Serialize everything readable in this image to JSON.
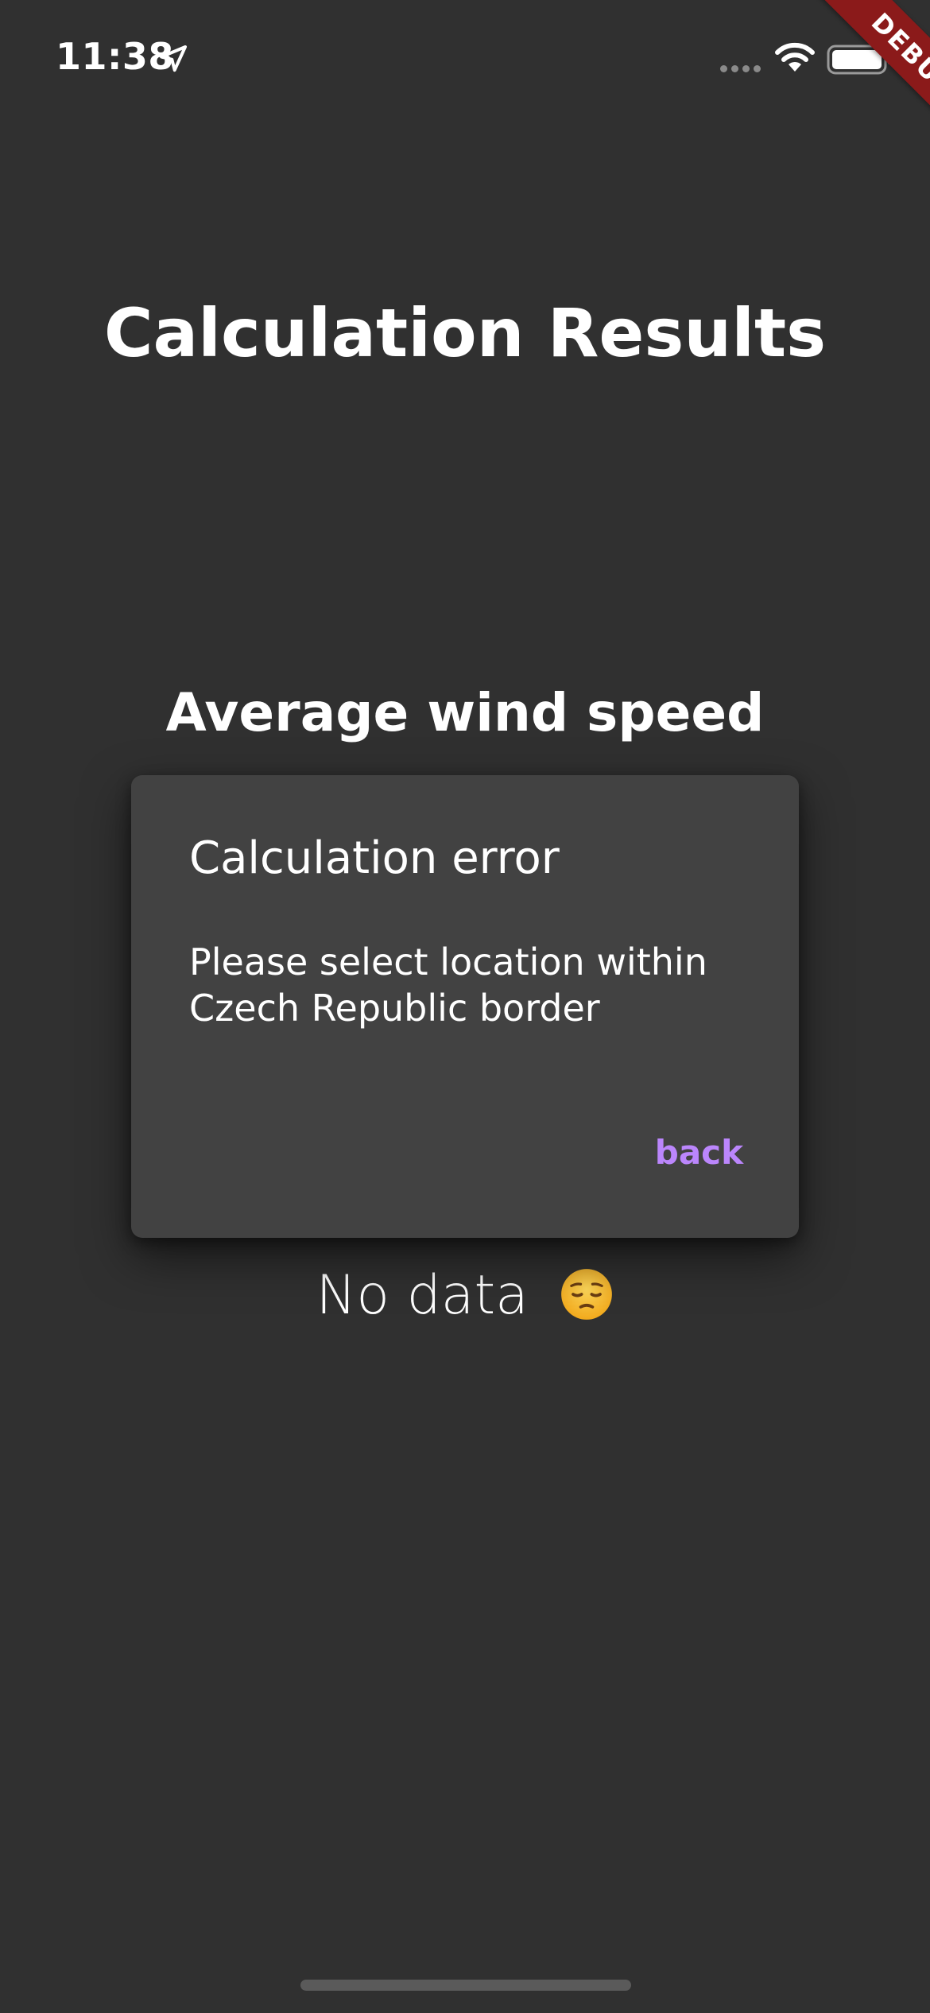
{
  "status_bar": {
    "time": "11:38"
  },
  "debug_banner": {
    "label": "DEBUG"
  },
  "page": {
    "title": "Calculation Results",
    "section_heading": "Average wind speed",
    "no_data_text": "No data",
    "no_data_emoji": "pensive-face-emoji"
  },
  "dialog": {
    "title": "Calculation error",
    "message": "Please select location within Czech Republic border",
    "back_label": "back"
  },
  "colors": {
    "background": "#303030",
    "dialog_background": "#424242",
    "accent": "#bb86fc",
    "debug_ribbon": "#8b1a1a"
  }
}
